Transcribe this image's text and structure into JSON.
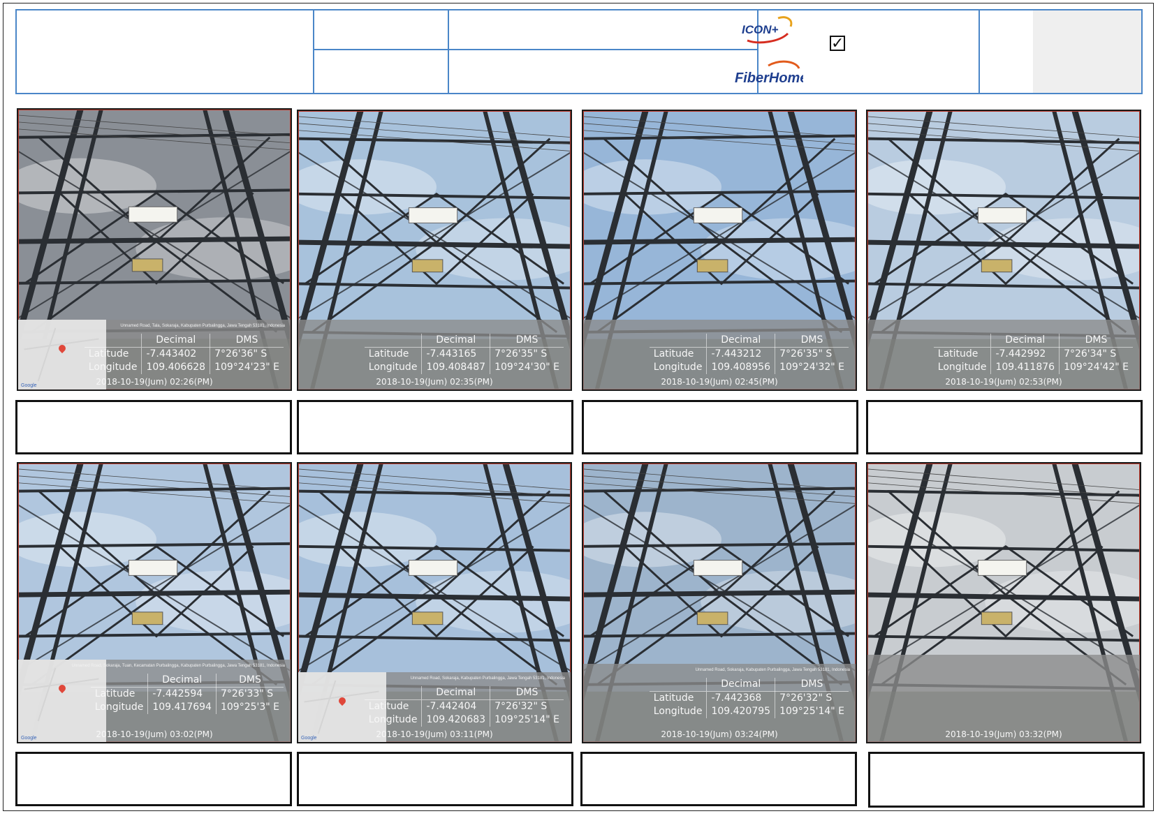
{
  "header": {
    "checkbox_glyph": "✓",
    "logos": [
      {
        "name": "ICON+",
        "text": "ICON+"
      },
      {
        "name": "FiberHome",
        "text": "FiberHome"
      }
    ]
  },
  "colors": {
    "header_border": "#4a86c8",
    "photo_border": "#c0392b",
    "overlay": "#8c8c8c"
  },
  "photos": [
    {
      "lat_label": "Latitude",
      "lon_label": "Longitude",
      "dec_head": "Decimal",
      "dms_head": "DMS",
      "lat_dec": "-7.443402",
      "lat_dms": "7°26'36\" S",
      "lon_dec": "109.406628",
      "lon_dms": "109°24'23\" E",
      "timestamp": "2018-10-19(Jum) 02:26(PM)",
      "address": "Unnamed Road, Tala, Sokaraja, Kabupaten Purbalingga, Jawa Tengah 53181, Indonesia",
      "map_tag": "Google"
    },
    {
      "lat_label": "Latitude",
      "lon_label": "Longitude",
      "dec_head": "Decimal",
      "dms_head": "DMS",
      "lat_dec": "-7.443165",
      "lat_dms": "7°26'35\" S",
      "lon_dec": "109.408487",
      "lon_dms": "109°24'30\" E",
      "timestamp": "2018-10-19(Jum) 02:35(PM)"
    },
    {
      "lat_label": "Latitude",
      "lon_label": "Longitude",
      "dec_head": "Decimal",
      "dms_head": "DMS",
      "lat_dec": "-7.443212",
      "lat_dms": "7°26'35\" S",
      "lon_dec": "109.408956",
      "lon_dms": "109°24'32\" E",
      "timestamp": "2018-10-19(Jum) 02:45(PM)"
    },
    {
      "lat_label": "Latitude",
      "lon_label": "Longitude",
      "dec_head": "Decimal",
      "dms_head": "DMS",
      "lat_dec": "-7.442992",
      "lat_dms": "7°26'34\" S",
      "lon_dec": "109.411876",
      "lon_dms": "109°24'42\" E",
      "timestamp": "2018-10-19(Jum) 02:53(PM)"
    },
    {
      "lat_label": "Latitude",
      "lon_label": "Longitude",
      "dec_head": "Decimal",
      "dms_head": "DMS",
      "lat_dec": "-7.442594",
      "lat_dms": "7°26'33\" S",
      "lon_dec": "109.417694",
      "lon_dms": "109°25'3\" E",
      "timestamp": "2018-10-19(Jum) 03:02(PM)",
      "address": "Unnamed Road, Sokaraja, Tuan, Kecamatan Purbalingga, Kabupaten Purbalingga, Jawa Tengah 53181, Indonesia",
      "map_tag": "Google"
    },
    {
      "lat_label": "Latitude",
      "lon_label": "Longitude",
      "dec_head": "Decimal",
      "dms_head": "DMS",
      "lat_dec": "-7.442404",
      "lat_dms": "7°26'32\" S",
      "lon_dec": "109.420683",
      "lon_dms": "109°25'14\" E",
      "timestamp": "2018-10-19(Jum) 03:11(PM)",
      "address": "Unnamed Road, Sokaraja, Kabupaten Purbalingga, Jawa Tengah 53181, Indonesia",
      "map_tag": "Google"
    },
    {
      "lat_label": "Latitude",
      "lon_label": "Longitude",
      "dec_head": "Decimal",
      "dms_head": "DMS",
      "lat_dec": "-7.442368",
      "lat_dms": "7°26'32\" S",
      "lon_dec": "109.420795",
      "lon_dms": "109°25'14\" E",
      "timestamp": "2018-10-19(Jum) 03:24(PM)",
      "address": "Unnamed Road, Sokaraja, Kabupaten Purbalingga, Jawa Tengah 53181, Indonesia"
    },
    {
      "timestamp": "2018-10-19(Jum) 03:32(PM)"
    }
  ]
}
